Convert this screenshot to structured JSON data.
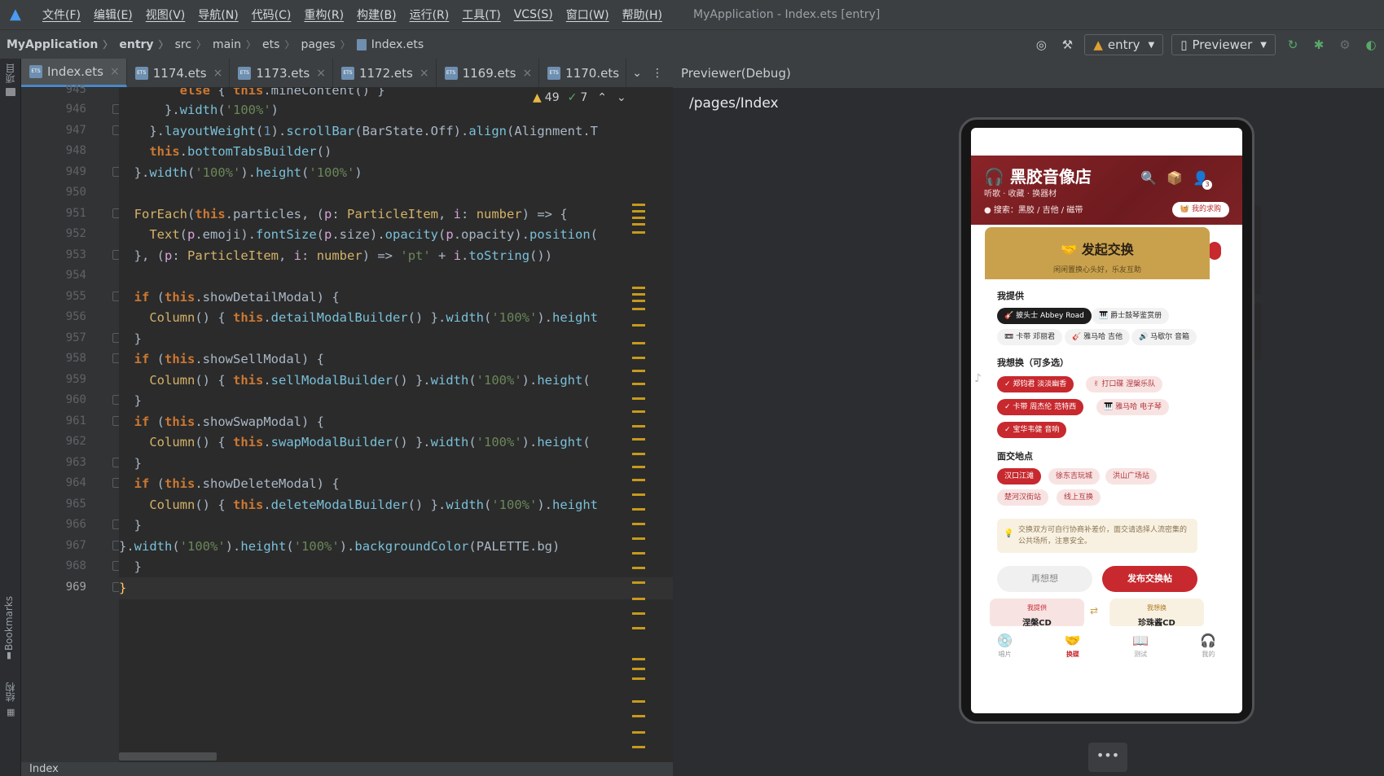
{
  "menubar": {
    "items": [
      "文件(F)",
      "编辑(E)",
      "视图(V)",
      "导航(N)",
      "代码(C)",
      "重构(R)",
      "构建(B)",
      "运行(R)",
      "工具(T)",
      "VCS(S)",
      "窗口(W)",
      "帮助(H)"
    ],
    "window_title": "MyApplication - Index.ets [entry]"
  },
  "breadcrumb": [
    "MyApplication",
    "entry",
    "src",
    "main",
    "ets",
    "pages",
    "Index.ets"
  ],
  "toolbar": {
    "module_select": "entry",
    "device_select": "Previewer"
  },
  "left_strip": {
    "project": "项目",
    "bookmarks": "Bookmarks",
    "structure": "结构"
  },
  "editor": {
    "tabs": [
      "Index.ets",
      "1174.ets",
      "1173.ets",
      "1172.ets",
      "1169.ets",
      "1170.ets"
    ],
    "warnings": "49",
    "checks": "7",
    "line_numbers": [
      "945",
      "946",
      "947",
      "948",
      "949",
      "950",
      "951",
      "952",
      "953",
      "954",
      "955",
      "956",
      "957",
      "958",
      "959",
      "960",
      "961",
      "962",
      "963",
      "964",
      "965",
      "966",
      "967",
      "968",
      "969"
    ],
    "current_line": "969"
  },
  "status_bar": {
    "text": "Index"
  },
  "previewer": {
    "title": "Previewer(Debug)",
    "path": "/pages/Index",
    "app": {
      "title": "黑胶音像店",
      "subtitle": "听歌 · 收藏 · 换器材",
      "search": "搜索：黑胶 / 吉他 / 磁带",
      "request_button": "我的求购",
      "badge": "3",
      "modal": {
        "title": "发起交换",
        "subtitle": "闲闲置换心头好，乐友互助",
        "offer_label": "我提供",
        "offer_items": [
          "披头士 Abbey Road",
          "爵士鼓琴鉴赏册",
          "卡带 邓丽君",
          "雅马哈 吉他",
          "马歇尔 音箱"
        ],
        "want_label": "我想换（可多选）",
        "want_items": [
          "✓ 郑钧君 淡淡幽香",
          "打口碟 涅槃乐队",
          "✓ 卡带 周杰伦 范特西",
          "雅马哈 电子琴",
          "✓ 宝华韦健 音响"
        ],
        "place_label": "面交地点",
        "places": [
          "汉口江滩",
          "徐东吉玩城",
          "洪山广场站",
          "楚河汉街站",
          "线上互换"
        ],
        "tip": "交换双方可自行协商补差价，面交请选择人流密集的公共场所，注意安全。",
        "cancel_button": "再想想",
        "submit_button": "发布交换帖"
      },
      "swap_preview": {
        "offer_label": "我提供",
        "offer_item": "涅槃CD",
        "want_label": "我想换",
        "want_item": "珍珠酱CD"
      },
      "tabbar": [
        "唱片",
        "换碟",
        "测试",
        "我的"
      ]
    }
  }
}
